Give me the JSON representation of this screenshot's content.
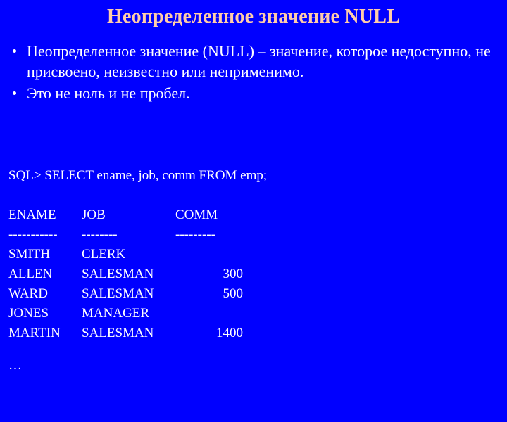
{
  "slide": {
    "background_color": "#0000FF",
    "title": "Неопределенное значение NULL",
    "title_color": "#FFCCAA",
    "body_color": "#FFFFFF"
  },
  "bullets": [
    {
      "marker": "bullet-dot",
      "text": "Неопределенное значение (NULL) – значение, которое недоступно, не присвоено, неизвестно или неприменимо."
    },
    {
      "marker": "bullet-dot",
      "text": "Это не ноль и не пробел."
    }
  ],
  "console": {
    "prompt_line": "SQL> SELECT ename, job, comm FROM emp;",
    "table": {
      "headers": {
        "ename": "ENAME",
        "job": "JOB",
        "comm": "COMM"
      },
      "separators": {
        "ename": "-----------",
        "job": "--------",
        "comm": "---------"
      },
      "rows": [
        {
          "ename": "SMITH",
          "job": "CLERK",
          "comm": ""
        },
        {
          "ename": "ALLEN",
          "job": "SALESMAN",
          "comm": "300"
        },
        {
          "ename": "WARD",
          "job": "SALESMAN",
          "comm": "500"
        },
        {
          "ename": "JONES",
          "job": "MANAGER",
          "comm": ""
        },
        {
          "ename": "MARTIN",
          "job": "SALESMAN",
          "comm": "1400"
        }
      ]
    },
    "truncation_marker": "…"
  }
}
